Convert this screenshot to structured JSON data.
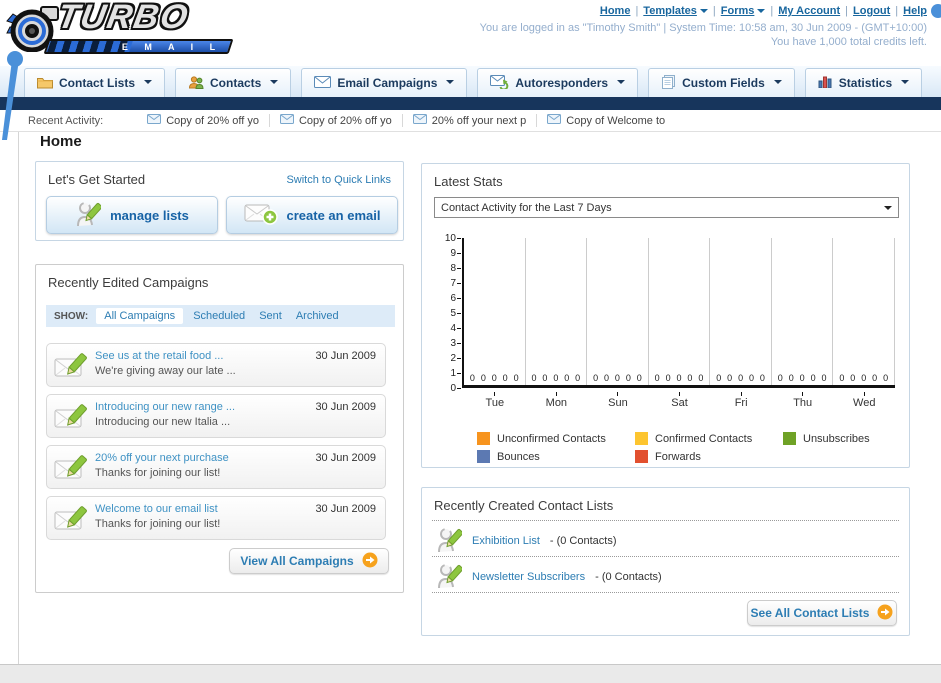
{
  "header": {
    "logo_main": "TURBO",
    "logo_sub": "E M A I L",
    "nav_links": [
      {
        "label": "Home",
        "dropdown": false
      },
      {
        "label": "Templates",
        "dropdown": true
      },
      {
        "label": "Forms",
        "dropdown": true
      },
      {
        "label": "My Account",
        "dropdown": false
      },
      {
        "label": "Logout",
        "dropdown": false
      },
      {
        "label": "Help",
        "dropdown": false
      }
    ],
    "login_info": "You are logged in as \"Timothy Smith\" | System Time: 10:58 am, 30 Jun 2009 - (GMT+10:00)",
    "credits_info": "You have 1,000 total credits left."
  },
  "main_nav": {
    "tabs": [
      {
        "label": "Contact Lists",
        "icon": "folder-icon"
      },
      {
        "label": "Contacts",
        "icon": "contacts-icon"
      },
      {
        "label": "Email Campaigns",
        "icon": "email-icon"
      },
      {
        "label": "Autoresponders",
        "icon": "autoresponder-icon"
      },
      {
        "label": "Custom Fields",
        "icon": "custom-fields-icon"
      },
      {
        "label": "Statistics",
        "icon": "statistics-icon"
      }
    ]
  },
  "recent_activity": {
    "label": "Recent Activity:",
    "items": [
      "Copy of 20% off yo",
      "Copy of 20% off yo",
      "20% off your next p",
      "Copy of Welcome to"
    ]
  },
  "page": {
    "title": "Home"
  },
  "get_started": {
    "title": "Let's Get Started",
    "switch_link": "Switch to Quick Links",
    "buttons": [
      {
        "label": "manage lists",
        "icon": "person-pencil-icon"
      },
      {
        "label": "create an email",
        "icon": "create-email-icon"
      }
    ]
  },
  "campaigns": {
    "title": "Recently Edited Campaigns",
    "show_label": "SHOW:",
    "filters": [
      "All Campaigns",
      "Scheduled",
      "Sent",
      "Archived"
    ],
    "active_filter": "All Campaigns",
    "items": [
      {
        "title": "See us at the retail food ...",
        "subtitle": "We're giving away our late ...",
        "date": "30 Jun 2009"
      },
      {
        "title": "Introducing our new range ...",
        "subtitle": "Introducing our new Italia ...",
        "date": "30 Jun 2009"
      },
      {
        "title": "20% off your next purchase",
        "subtitle": "Thanks for joining our list!",
        "date": "30 Jun 2009"
      },
      {
        "title": "Welcome to our email list",
        "subtitle": "Thanks for joining our list!",
        "date": "30 Jun 2009"
      }
    ],
    "view_all_label": "View All Campaigns"
  },
  "stats": {
    "title": "Latest Stats",
    "dropdown_value": "Contact Activity for the Last 7 Days"
  },
  "chart_data": {
    "type": "bar",
    "title": "Contact Activity for the Last 7 Days",
    "categories": [
      "Tue",
      "Mon",
      "Sun",
      "Sat",
      "Fri",
      "Thu",
      "Wed"
    ],
    "series": [
      {
        "name": "Unconfirmed Contacts",
        "color": "#F7941E",
        "values": [
          0,
          0,
          0,
          0,
          0,
          0,
          0
        ]
      },
      {
        "name": "Confirmed Contacts",
        "color": "#FDC52F",
        "values": [
          0,
          0,
          0,
          0,
          0,
          0,
          0
        ]
      },
      {
        "name": "Unsubscribes",
        "color": "#6FA226",
        "values": [
          0,
          0,
          0,
          0,
          0,
          0,
          0
        ]
      },
      {
        "name": "Bounces",
        "color": "#5C79B2",
        "values": [
          0,
          0,
          0,
          0,
          0,
          0,
          0
        ]
      },
      {
        "name": "Forwards",
        "color": "#E2502F",
        "values": [
          0,
          0,
          0,
          0,
          0,
          0,
          0
        ]
      }
    ],
    "ylim": [
      0,
      10
    ],
    "ytick_step": 1,
    "grid": "vertical-only",
    "legend_position": "bottom",
    "value_labels_shown": true
  },
  "contact_lists": {
    "title": "Recently Created Contact Lists",
    "items": [
      {
        "name": "Exhibition List",
        "count": "- (0 Contacts)"
      },
      {
        "name": "Newsletter Subscribers",
        "count": "- (0 Contacts)"
      }
    ],
    "see_all_label": "See All Contact Lists"
  }
}
